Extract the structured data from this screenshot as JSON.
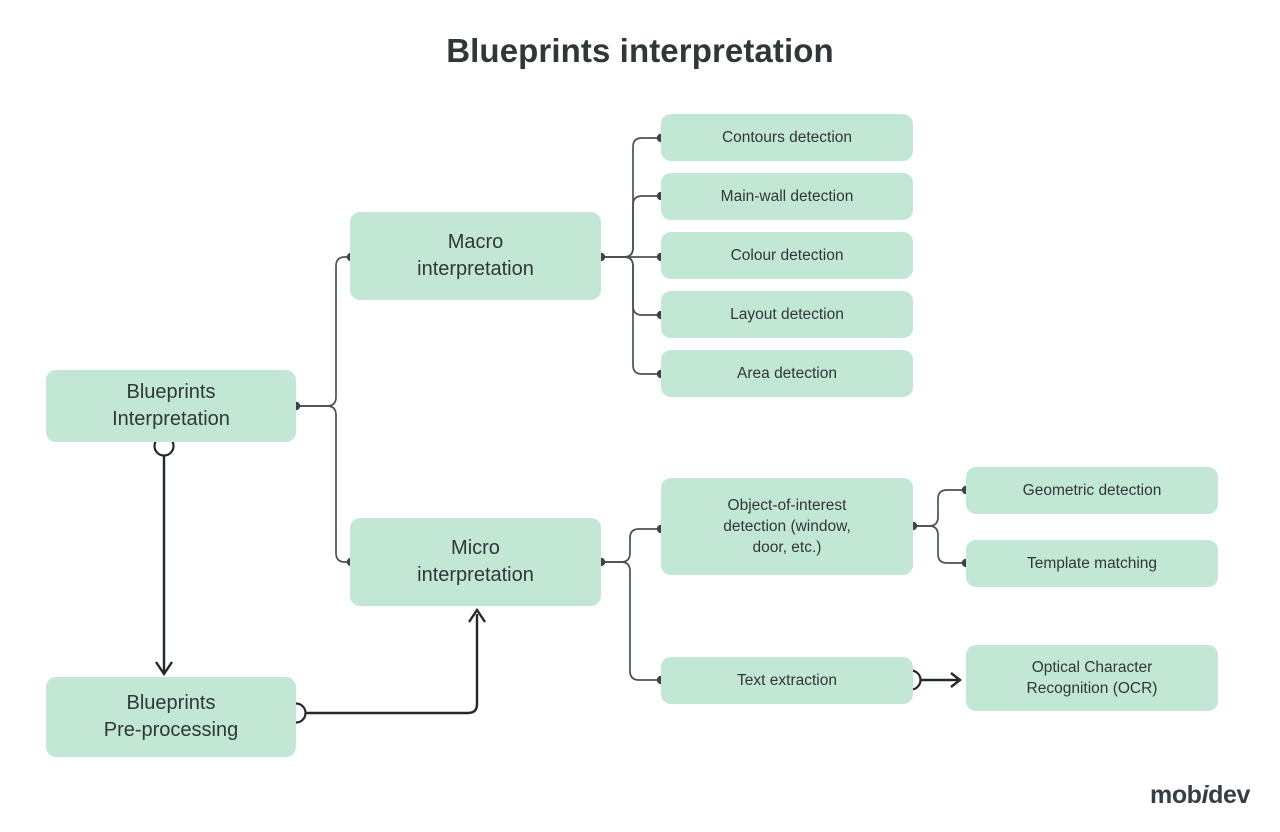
{
  "title": "Blueprints interpretation",
  "brand": {
    "part1": "mob",
    "part2": "i",
    "part3": "dev"
  },
  "colors": {
    "node_fill": "#c2e8d5",
    "text": "#2f3739",
    "wire": "#4a5254",
    "wire_strong": "#222a2c",
    "background": "#ffffff"
  },
  "nodes": {
    "root": {
      "label": "Blueprints\nInterpretation"
    },
    "preprocessing": {
      "label": "Blueprints\nPre-processing"
    },
    "macro": {
      "label": "Macro\ninterpretation"
    },
    "micro": {
      "label": "Micro\ninterpretation"
    },
    "macro_children": [
      {
        "label": "Contours detection"
      },
      {
        "label": "Main-wall detection"
      },
      {
        "label": "Colour detection"
      },
      {
        "label": "Layout detection"
      },
      {
        "label": "Area detection"
      }
    ],
    "micro_children": [
      {
        "label": "Object-of-interest\ndetection (window,\ndoor, etc.)"
      },
      {
        "label": "Text extraction"
      }
    ],
    "object_children": [
      {
        "label": "Geometric detection"
      },
      {
        "label": "Template matching"
      }
    ],
    "text_children": [
      {
        "label": "Optical Character\nRecognition (OCR)"
      }
    ]
  }
}
